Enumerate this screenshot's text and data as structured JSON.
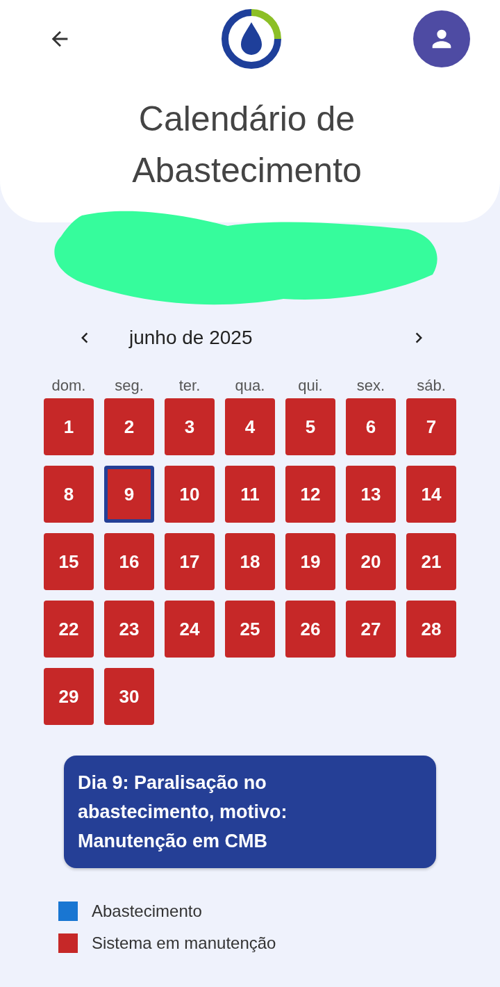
{
  "header": {
    "title": "Calendário de Abastecimento"
  },
  "calendar": {
    "month": "junho de 2025",
    "weekdays": [
      "dom.",
      "seg.",
      "ter.",
      "qua.",
      "qui.",
      "sex.",
      "sáb."
    ],
    "days": [
      {
        "label": "1",
        "color": "#c62828",
        "selected": false
      },
      {
        "label": "2",
        "color": "#c62828",
        "selected": false
      },
      {
        "label": "3",
        "color": "#c62828",
        "selected": false
      },
      {
        "label": "4",
        "color": "#c62828",
        "selected": false
      },
      {
        "label": "5",
        "color": "#c62828",
        "selected": false
      },
      {
        "label": "6",
        "color": "#c62828",
        "selected": false
      },
      {
        "label": "7",
        "color": "#c62828",
        "selected": false
      },
      {
        "label": "8",
        "color": "#c62828",
        "selected": false
      },
      {
        "label": "9",
        "color": "#c62828",
        "selected": true
      },
      {
        "label": "10",
        "color": "#c62828",
        "selected": false
      },
      {
        "label": "11",
        "color": "#c62828",
        "selected": false
      },
      {
        "label": "12",
        "color": "#c62828",
        "selected": false
      },
      {
        "label": "13",
        "color": "#c62828",
        "selected": false
      },
      {
        "label": "14",
        "color": "#c62828",
        "selected": false
      },
      {
        "label": "15",
        "color": "#c62828",
        "selected": false
      },
      {
        "label": "16",
        "color": "#c62828",
        "selected": false
      },
      {
        "label": "17",
        "color": "#c62828",
        "selected": false
      },
      {
        "label": "18",
        "color": "#c62828",
        "selected": false
      },
      {
        "label": "19",
        "color": "#c62828",
        "selected": false
      },
      {
        "label": "20",
        "color": "#c62828",
        "selected": false
      },
      {
        "label": "21",
        "color": "#c62828",
        "selected": false
      },
      {
        "label": "22",
        "color": "#c62828",
        "selected": false
      },
      {
        "label": "23",
        "color": "#c62828",
        "selected": false
      },
      {
        "label": "24",
        "color": "#c62828",
        "selected": false
      },
      {
        "label": "25",
        "color": "#c62828",
        "selected": false
      },
      {
        "label": "26",
        "color": "#c62828",
        "selected": false
      },
      {
        "label": "27",
        "color": "#c62828",
        "selected": false
      },
      {
        "label": "28",
        "color": "#c62828",
        "selected": false
      },
      {
        "label": "29",
        "color": "#c62828",
        "selected": false
      },
      {
        "label": "30",
        "color": "#c62828",
        "selected": false
      }
    ]
  },
  "info": {
    "text": "Dia 9: Paralisação no abastecimento, motivo: Manutenção em CMB"
  },
  "legend": [
    {
      "label": "Abastecimento",
      "color": "#1976d2"
    },
    {
      "label": "Sistema em manutenção",
      "color": "#c62828"
    }
  ]
}
